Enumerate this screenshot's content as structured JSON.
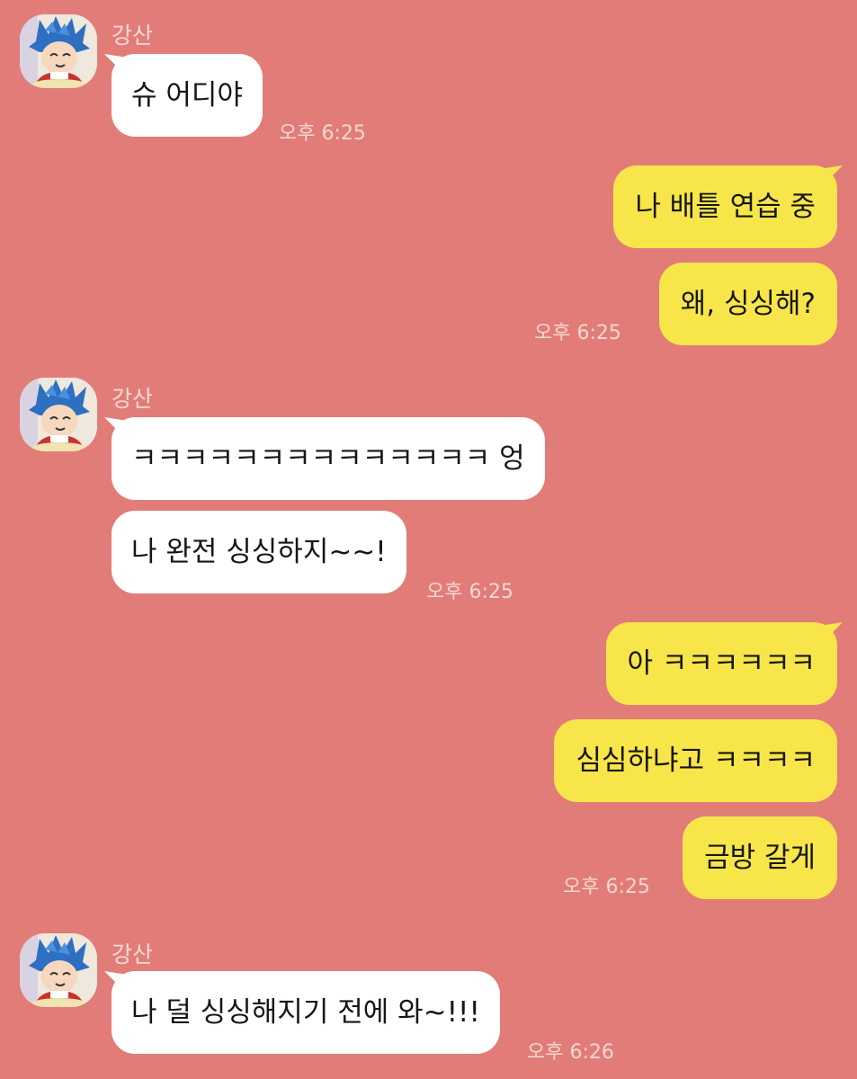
{
  "contact": {
    "name": "강산"
  },
  "groups": [
    {
      "side": "in",
      "messages": [
        "슈 어디야"
      ],
      "time": "오후 6:25"
    },
    {
      "side": "out",
      "messages": [
        "나 배틀 연습 중",
        "왜, 싱싱해?"
      ],
      "time": "오후 6:25"
    },
    {
      "side": "in",
      "messages": [
        "ㅋㅋㅋㅋㅋㅋㅋㅋㅋㅋㅋㅋㅋㅋ 엉",
        "나 완전 싱싱하지~~!"
      ],
      "time": "오후 6:25"
    },
    {
      "side": "out",
      "messages": [
        "아 ㅋㅋㅋㅋㅋㅋ",
        "심심하냐고 ㅋㅋㅋㅋ",
        "금방 갈게"
      ],
      "time": "오후 6:25"
    },
    {
      "side": "in",
      "messages": [
        "나 덜 싱싱해지기 전에 와~!!!"
      ],
      "time": "오후 6:26"
    }
  ],
  "colors": {
    "background": "#e27c78",
    "incoming_bubble": "#ffffff",
    "outgoing_bubble": "#f8e54a"
  },
  "icons": {
    "avatar": "avatar-icon"
  }
}
